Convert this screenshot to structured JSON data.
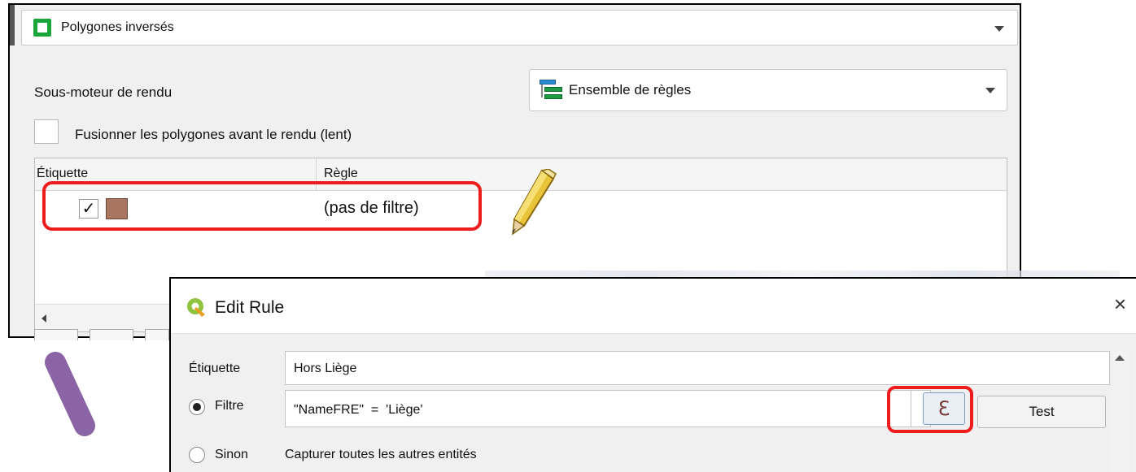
{
  "renderer_panel": {
    "symbol_type": "Polygones inversés",
    "sub_renderer_label": "Sous-moteur de rendu",
    "sub_renderer_value": "Ensemble de règles",
    "merge_label": "Fusionner les polygones avant le rendu (lent)",
    "merge_checked": false,
    "table": {
      "headers": [
        "Étiquette",
        "Règle"
      ],
      "rows": [
        {
          "checked": true,
          "swatch_color": "#a87561",
          "label": "",
          "rule": "(pas de filtre)"
        }
      ]
    }
  },
  "edit_rule_dialog": {
    "title": "Edit Rule",
    "close_glyph": "×",
    "etiquette_label": "Étiquette",
    "etiquette_value": "Hors Liège",
    "filtre_label": "Filtre",
    "filtre_value": "\"NameFRE\"  =  'Liège'",
    "filtre_selected": true,
    "expression_button": "ℇ",
    "test_button": "Test",
    "sinon_label": "Sinon",
    "sinon_desc": "Capturer toutes les autres entités",
    "sinon_selected": false
  },
  "colors": {
    "highlight": "#ee1c1c",
    "annotation_purple": "#8a64a5"
  }
}
